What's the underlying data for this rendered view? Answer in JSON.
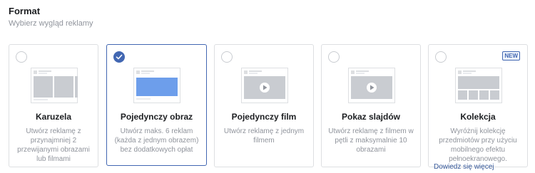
{
  "header": {
    "title": "Format",
    "subtitle": "Wybierz wygląd reklamy"
  },
  "cards": [
    {
      "title": "Karuzela",
      "desc": "Utwórz reklamę z przynajmniej 2 przewijanymi obrazami lub filmami",
      "selected": false,
      "icon": "carousel-thumbnail"
    },
    {
      "title": "Pojedynczy obraz",
      "desc": "Utwórz maks. 6 reklam (każda z jednym obrazem) bez dodatkowych opłat",
      "selected": true,
      "icon": "single-image-thumbnail"
    },
    {
      "title": "Pojedynczy film",
      "desc": "Utwórz reklamę z jednym filmem",
      "selected": false,
      "icon": "single-video-thumbnail"
    },
    {
      "title": "Pokaz slajdów",
      "desc": "Utwórz reklamę z filmem w pętli z maksymalnie 10 obrazami",
      "selected": false,
      "icon": "slideshow-thumbnail"
    },
    {
      "title": "Kolekcja",
      "desc": "Wyróżnij kolekcję przedmiotów przy użyciu mobilnego efektu pełnoekranowego.",
      "selected": false,
      "icon": "collection-thumbnail",
      "badge": "NEW"
    }
  ],
  "learn_more": "Dowiedz się więcej",
  "colors": {
    "accent": "#4267b2",
    "border": "#dddfe2",
    "muted": "#90949c",
    "link": "#365899"
  }
}
